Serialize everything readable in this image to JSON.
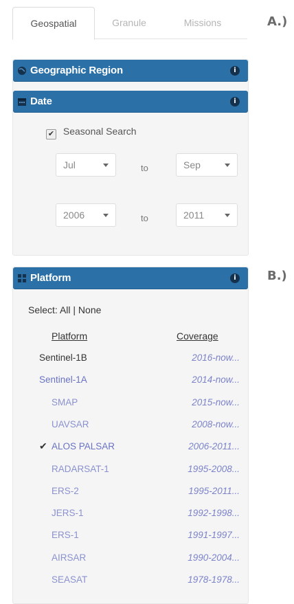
{
  "figure_labels": {
    "a": "A.)",
    "b": "B.)"
  },
  "tabs": [
    {
      "label": "Geospatial",
      "active": true
    },
    {
      "label": "Granule",
      "active": false
    },
    {
      "label": "Missions",
      "active": false
    }
  ],
  "geographic": {
    "title": "Geographic Region",
    "icon": "globe-icon"
  },
  "date": {
    "title": "Date",
    "icon": "calendar-icon",
    "seasonal_label": "Seasonal Search",
    "seasonal_checked": true,
    "month_from": "Jul",
    "month_to": "Sep",
    "year_from": "2006",
    "year_to": "2011",
    "to_label": "to"
  },
  "platform": {
    "title": "Platform",
    "icon": "grid-icon",
    "select_prefix": "Select:",
    "select_all": "All",
    "select_sep": "|",
    "select_none": "None",
    "col_platform": "Platform",
    "col_coverage": "Coverage",
    "rows": [
      {
        "name": "Sentinel-1B",
        "coverage": "2016-now...",
        "indent": 0,
        "checked": false,
        "name_color": "#333333"
      },
      {
        "name": "Sentinel-1A",
        "coverage": "2014-now...",
        "indent": 0,
        "checked": false,
        "name_color": "#6a73c2"
      },
      {
        "name": "SMAP",
        "coverage": "2015-now...",
        "indent": 1,
        "checked": false,
        "name_color": "#8a91cf"
      },
      {
        "name": "UAVSAR",
        "coverage": "2008-now...",
        "indent": 1,
        "checked": false,
        "name_color": "#8a91cf"
      },
      {
        "name": "ALOS PALSAR",
        "coverage": "2006-2011...",
        "indent": 1,
        "checked": true,
        "name_color": "#6a73c2"
      },
      {
        "name": "RADARSAT-1",
        "coverage": "1995-2008...",
        "indent": 1,
        "checked": false,
        "name_color": "#8a91cf"
      },
      {
        "name": "ERS-2",
        "coverage": "1995-2011...",
        "indent": 1,
        "checked": false,
        "name_color": "#8a91cf"
      },
      {
        "name": "JERS-1",
        "coverage": "1992-1998...",
        "indent": 1,
        "checked": false,
        "name_color": "#8a91cf"
      },
      {
        "name": "ERS-1",
        "coverage": "1991-1997...",
        "indent": 1,
        "checked": false,
        "name_color": "#8a91cf"
      },
      {
        "name": "AIRSAR",
        "coverage": "1990-2004...",
        "indent": 1,
        "checked": false,
        "name_color": "#8a91cf"
      },
      {
        "name": "SEASAT",
        "coverage": "1978-1978...",
        "indent": 1,
        "checked": false,
        "name_color": "#8a91cf"
      }
    ]
  },
  "colors": {
    "header_bar": "#2b71a8",
    "panel_bg": "#f5f5f5",
    "link": "#6a73c2"
  }
}
